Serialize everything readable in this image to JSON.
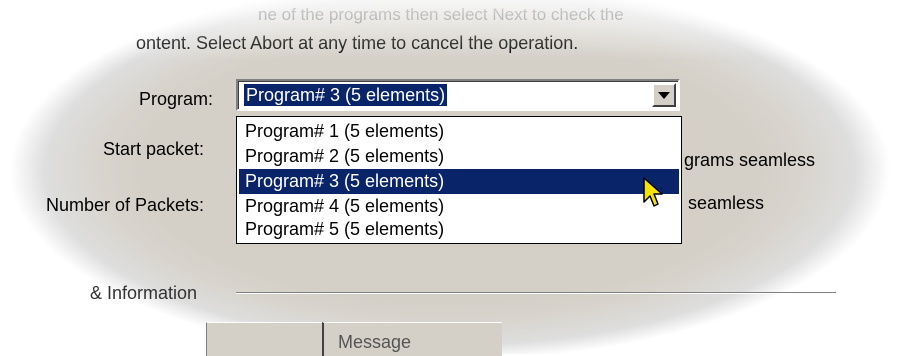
{
  "instructions": {
    "line1": "ne of the programs then select Next to check the",
    "line2": "ontent.  Select Abort at any time to cancel the operation."
  },
  "program": {
    "label": "Program:",
    "selected": "Program# 3  (5 elements)",
    "options": [
      "Program# 1  (5 elements)",
      "Program# 2  (5 elements)",
      "Program# 3  (5 elements)",
      "Program# 4  (5 elements)",
      "Program# 5  (5 elements)"
    ]
  },
  "start_packet": {
    "label": "Start packet:",
    "checkbox_tail": "grams seamless"
  },
  "num_packets": {
    "label": "Number of Packets:",
    "checkbox_tail": "seamless"
  },
  "info_group": {
    "label": "& Information"
  },
  "list_header": {
    "message": "Message"
  },
  "colors": {
    "selection": "#0a246a",
    "dialog_bg": "#d4d0c8"
  }
}
